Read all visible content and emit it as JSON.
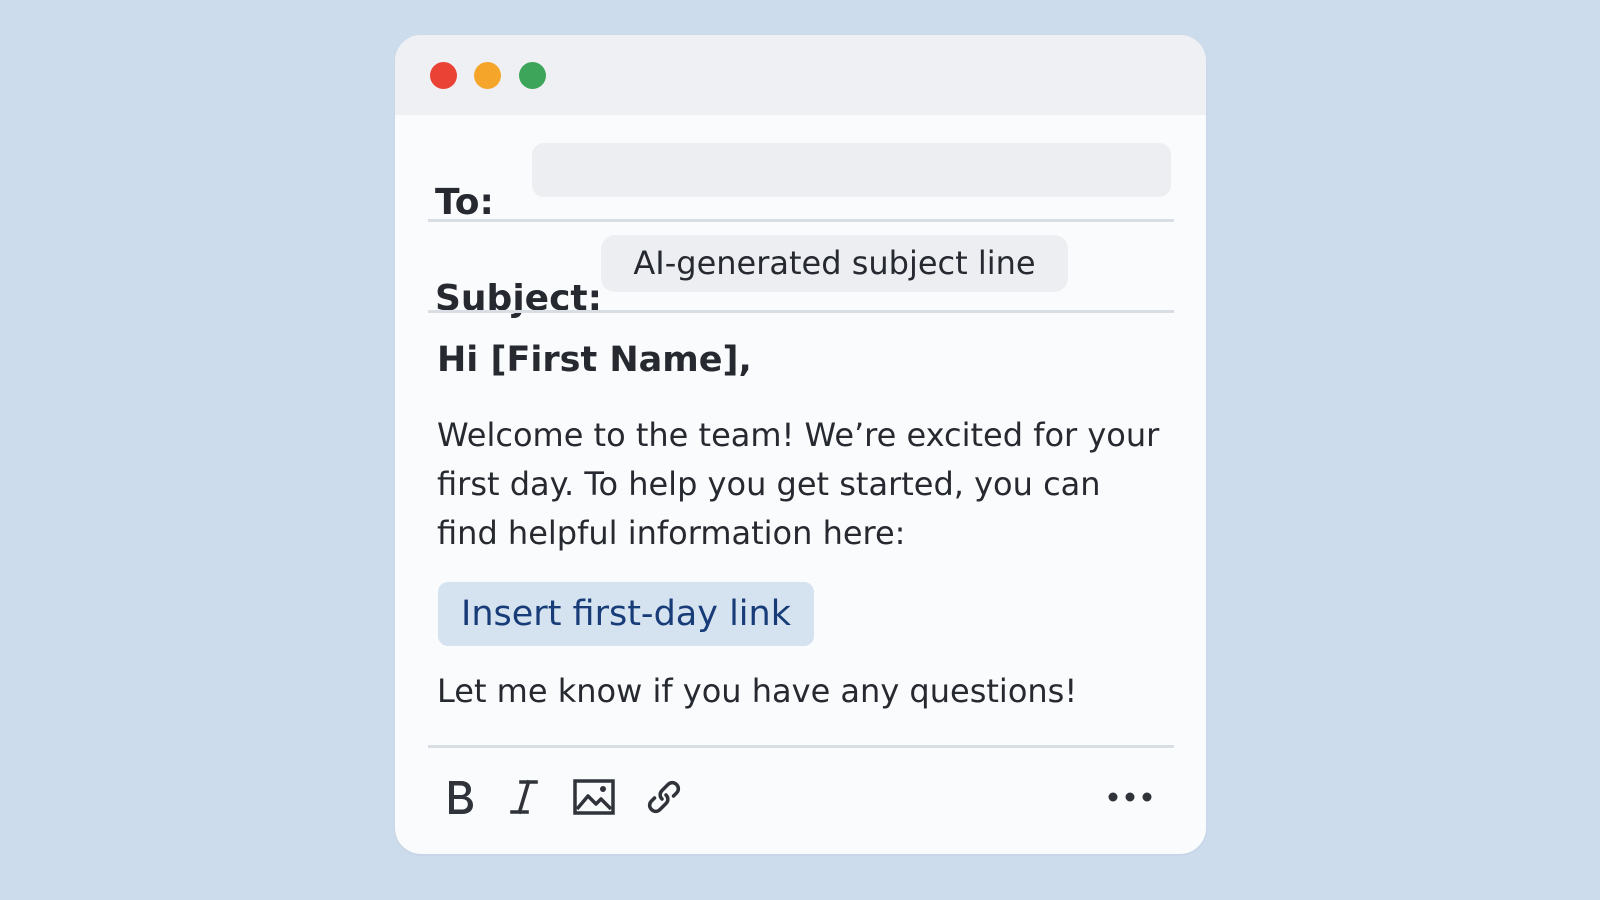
{
  "window": {
    "controls": [
      "close",
      "minimize",
      "maximize"
    ]
  },
  "compose": {
    "to_label": "To:",
    "to_value": "",
    "subject_label": "Subject:",
    "subject_value": "AI-generated subject line"
  },
  "body": {
    "greeting": "Hi [First Name],",
    "paragraph": "Welcome to the team! We’re excited for your first day. To help you get started, you can find helpful information here:",
    "link_placeholder": "Insert first-day link",
    "closing": "Let me know if you have any questions!"
  },
  "toolbar": {
    "icons": [
      "bold-icon",
      "italic-icon",
      "image-icon",
      "link-icon",
      "more-icon"
    ]
  },
  "colors": {
    "background": "#cddcec",
    "window": "#fafbfc",
    "titlebar": "#eef0f3",
    "close_dot": "#ea4335",
    "minimize_dot": "#f5a62a",
    "maximize_dot": "#3da55a",
    "link_chip_bg": "#d5e2f0",
    "link_chip_text": "#173c78"
  }
}
